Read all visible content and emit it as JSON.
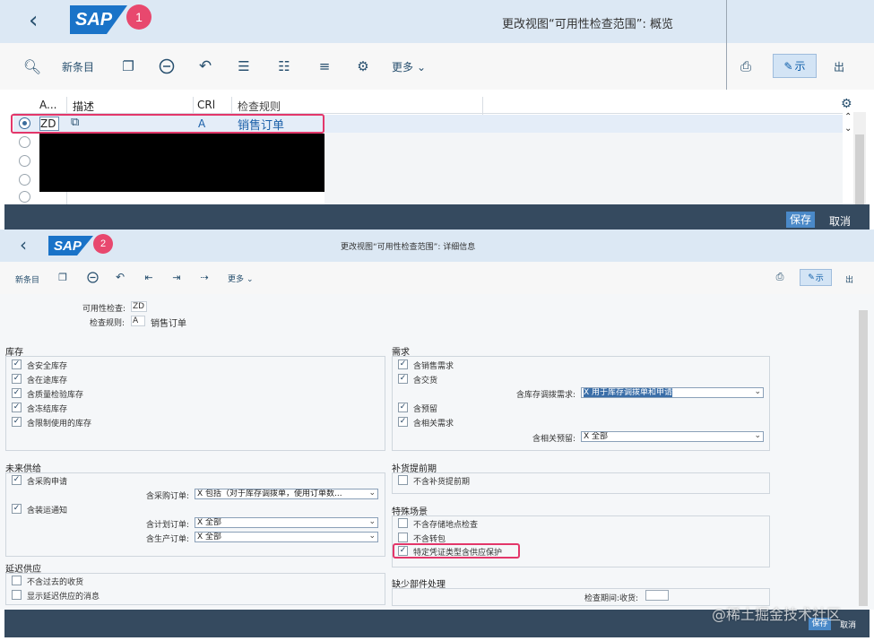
{
  "top": {
    "logo": "SAP",
    "badge": "1",
    "title": "更改视图“可用性检查范围”: 概览",
    "toolbar": {
      "new_entry": "新条目",
      "more": "更多",
      "display": "示",
      "exit": "出"
    },
    "table": {
      "headers": [
        "A...",
        "描述",
        "CRl",
        "检查规则"
      ],
      "row": {
        "key": "ZD",
        "crl": "A",
        "rule": "销售订单"
      }
    },
    "footer": {
      "save": "保存",
      "cancel": "取消"
    }
  },
  "bottom": {
    "logo": "SAP",
    "badge": "2",
    "title": "更改视图“可用性检查范围”: 详细信息",
    "toolbar": {
      "new_entry": "新条目",
      "more": "更多",
      "display": "示",
      "exit": "出"
    },
    "header_fields": {
      "avail_label": "可用性检查:",
      "avail_value": "ZD",
      "rule_label": "检查规则:",
      "rule_value": "A",
      "rule_text": "销售订单"
    },
    "stock": {
      "title": "库存",
      "items": [
        {
          "label": "含安全库存",
          "checked": true
        },
        {
          "label": "含在途库存",
          "checked": true
        },
        {
          "label": "含质量检验库存",
          "checked": true
        },
        {
          "label": "含冻结库存",
          "checked": true
        },
        {
          "label": "含限制使用的库存",
          "checked": true
        }
      ]
    },
    "demand": {
      "title": "需求",
      "items": [
        {
          "label": "含销售需求",
          "checked": true
        },
        {
          "label": "含交货",
          "checked": true
        },
        {
          "label": "含预留",
          "checked": true
        },
        {
          "label": "含相关需求",
          "checked": true
        }
      ],
      "transfer_label": "含库存调拨需求:",
      "transfer_value": "X 用于库存调拨单和申请",
      "related_label": "含相关预留:",
      "related_value": "X 全部"
    },
    "future": {
      "title": "未来供给",
      "purchase_req": "含采购申请",
      "shipping_notice": "含装运通知",
      "po_label": "含采购订单:",
      "po_value": "X 包括（对于库存调拨单，使用订单数...",
      "plan_label": "含计划订单:",
      "plan_value": "X 全部",
      "prod_label": "含生产订单:",
      "prod_value": "X 全部"
    },
    "replenish": {
      "title": "补货提前期",
      "item": "不含补货提前期"
    },
    "special": {
      "title": "特殊场景",
      "items": [
        {
          "label": "不含存储地点检查",
          "checked": false
        },
        {
          "label": "不含转包",
          "checked": false
        },
        {
          "label": "特定凭证类型含供应保护",
          "checked": true
        }
      ]
    },
    "delayed": {
      "title": "延迟供应",
      "items": [
        {
          "label": "不含过去的收货",
          "checked": false
        },
        {
          "label": "显示延迟供应的消息",
          "checked": false
        }
      ]
    },
    "missing": {
      "title": "缺少部件处理",
      "period_label": "检查期间:收货:"
    },
    "footer": {
      "save": "保存",
      "cancel": "取消"
    }
  },
  "watermark": "@稀土掘金技术社区"
}
